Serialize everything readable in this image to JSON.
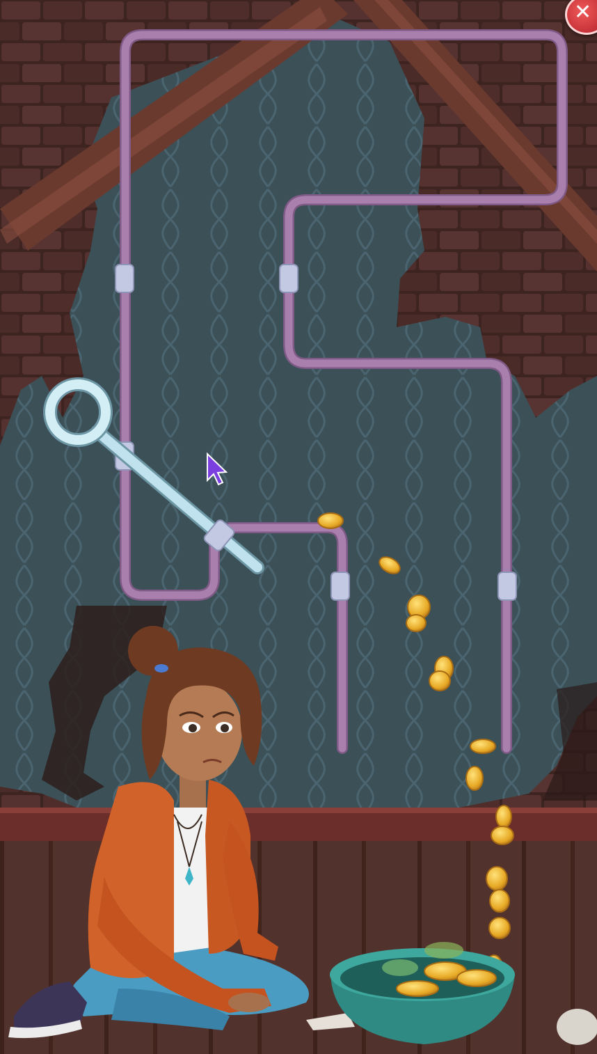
{
  "screen": {
    "name": "pull-the-pin-puzzle",
    "close_icon": "close-icon",
    "cursor_icon": "arrow-cursor-icon"
  },
  "colors": {
    "pipe": "#a980ad",
    "pipe_dark": "#7f5a86",
    "clamp": "#c3c9e3",
    "pin": "#bfe2ee",
    "wall": "#3c5058",
    "wallpaper_pattern": "#4d6670",
    "brick": "#4f2c28",
    "beam": "#6a3a2f",
    "floor": "#5e3a34",
    "coin": "#e8b52a",
    "bowl": "#2f8a83",
    "cursor": "#7b3fe0"
  },
  "pieces": {
    "pin": "pull-pin",
    "coins": "gold-coin-icons",
    "bowl": "green-bowl",
    "character": "sad-girl-character"
  }
}
